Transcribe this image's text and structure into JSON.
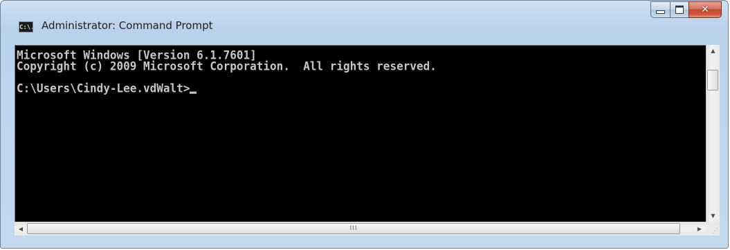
{
  "window": {
    "title": "Administrator: Command Prompt",
    "icon": "cmd-icon",
    "icon_text": "C:\\.",
    "buttons": {
      "minimize": "minimize-icon",
      "maximize": "maximize-icon",
      "close": "close-icon"
    }
  },
  "console": {
    "lines": [
      "Microsoft Windows [Version 6.1.7601]",
      "Copyright (c) 2009 Microsoft Corporation.  All rights reserved.",
      "",
      "C:\\Users\\Cindy-Lee.vdWalt>"
    ],
    "text_color": "#c6c6c6",
    "background_color": "#000000"
  },
  "scrollbars": {
    "vertical": {
      "up_icon": "arrow-up-icon",
      "down_icon": "arrow-down-icon"
    },
    "horizontal": {
      "left_icon": "arrow-left-icon",
      "right_icon": "arrow-right-icon",
      "grip": "III"
    }
  }
}
